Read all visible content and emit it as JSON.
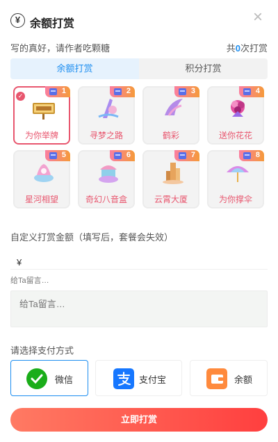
{
  "header": {
    "title": "余额打赏",
    "yen_symbol": "¥",
    "close_symbol": "×"
  },
  "subline": {
    "left": "写的真好，请作者吃颗糖",
    "prefix": "共",
    "count": "0",
    "suffix": "次打赏"
  },
  "tabs": [
    {
      "label": "余额打赏",
      "active": true
    },
    {
      "label": "积分打赏",
      "active": false
    }
  ],
  "gifts": [
    {
      "name": "为你举牌",
      "badge": "1",
      "selected": true
    },
    {
      "name": "寻梦之路",
      "badge": "2"
    },
    {
      "name": "鹤彩",
      "badge": "3"
    },
    {
      "name": "送你花花",
      "badge": "4"
    },
    {
      "name": "星河相望",
      "badge": "5"
    },
    {
      "name": "奇幻八音盒",
      "badge": "6"
    },
    {
      "name": "云霄大厦",
      "badge": "7"
    },
    {
      "name": "为你撑伞",
      "badge": "8"
    }
  ],
  "custom": {
    "label": "自定义打赏金额（填写后，套餐会失效）",
    "currency": "¥",
    "value": ""
  },
  "message": {
    "hint": "给Ta留言…",
    "placeholder": "给Ta留言…"
  },
  "payment": {
    "label": "请选择支付方式",
    "methods": [
      {
        "label": "微信",
        "icon": "wechat-icon",
        "color": "#1aad19",
        "active": true
      },
      {
        "label": "支付宝",
        "icon": "alipay-icon",
        "color": "#1677ff"
      },
      {
        "label": "余额",
        "icon": "wallet-icon",
        "color": "#ff8a3d"
      }
    ]
  },
  "submit_label": "立即打赏"
}
